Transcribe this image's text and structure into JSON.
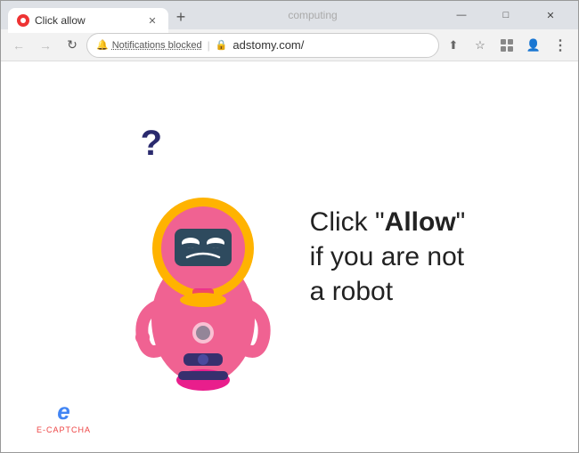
{
  "window": {
    "title": "Click allow",
    "controls": {
      "minimize": "—",
      "maximize": "□",
      "close": "✕"
    }
  },
  "tab": {
    "favicon_color": "#e33",
    "title": "Click allow",
    "close": "✕"
  },
  "new_tab_btn": "+",
  "watermark": "computing",
  "toolbar": {
    "back": "←",
    "forward": "→",
    "reload": "↻",
    "notifications_blocked": "Notifications blocked",
    "lock": "🔒",
    "url": "adstomy.com/",
    "share_icon": "⬆",
    "bookmark_icon": "☆",
    "extensions_icon": "□",
    "account_icon": "👤",
    "menu_icon": "⋮"
  },
  "page": {
    "text_line1": "Click \"",
    "text_bold": "Allow",
    "text_line1_end": "\"",
    "text_line2": "if you are not",
    "text_line3": "a robot",
    "captcha_label": "E-CAPTCHA"
  }
}
